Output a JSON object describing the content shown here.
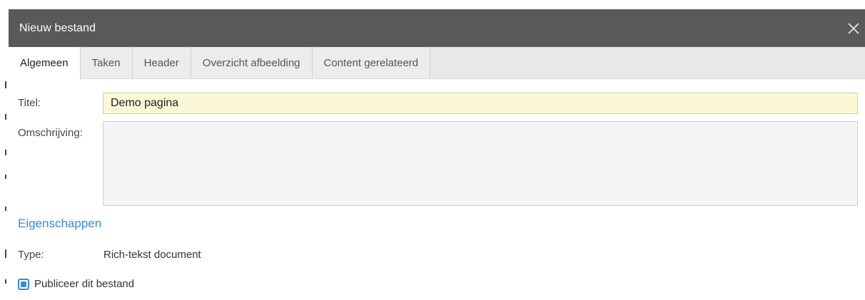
{
  "dialog": {
    "title": "Nieuw bestand",
    "close_icon": "close-icon"
  },
  "tabs": [
    {
      "label": "Algemeen",
      "active": true
    },
    {
      "label": "Taken",
      "active": false
    },
    {
      "label": "Header",
      "active": false
    },
    {
      "label": "Overzicht afbeelding",
      "active": false
    },
    {
      "label": "Content gerelateerd",
      "active": false
    }
  ],
  "form": {
    "title_label": "Titel:",
    "title_value": "Demo pagina",
    "description_label": "Omschrijving:",
    "description_value": ""
  },
  "properties": {
    "heading": "Eigenschappen",
    "type_label": "Type:",
    "type_value": "Rich-tekst document",
    "publish_label": "Publiceer dit bestand",
    "publish_checked": true
  },
  "colors": {
    "titlebar_bg": "#595959",
    "accent_blue": "#3a8bd1",
    "title_input_bg": "#fbf8d8",
    "tabbar_bg": "#e8e8e8"
  }
}
